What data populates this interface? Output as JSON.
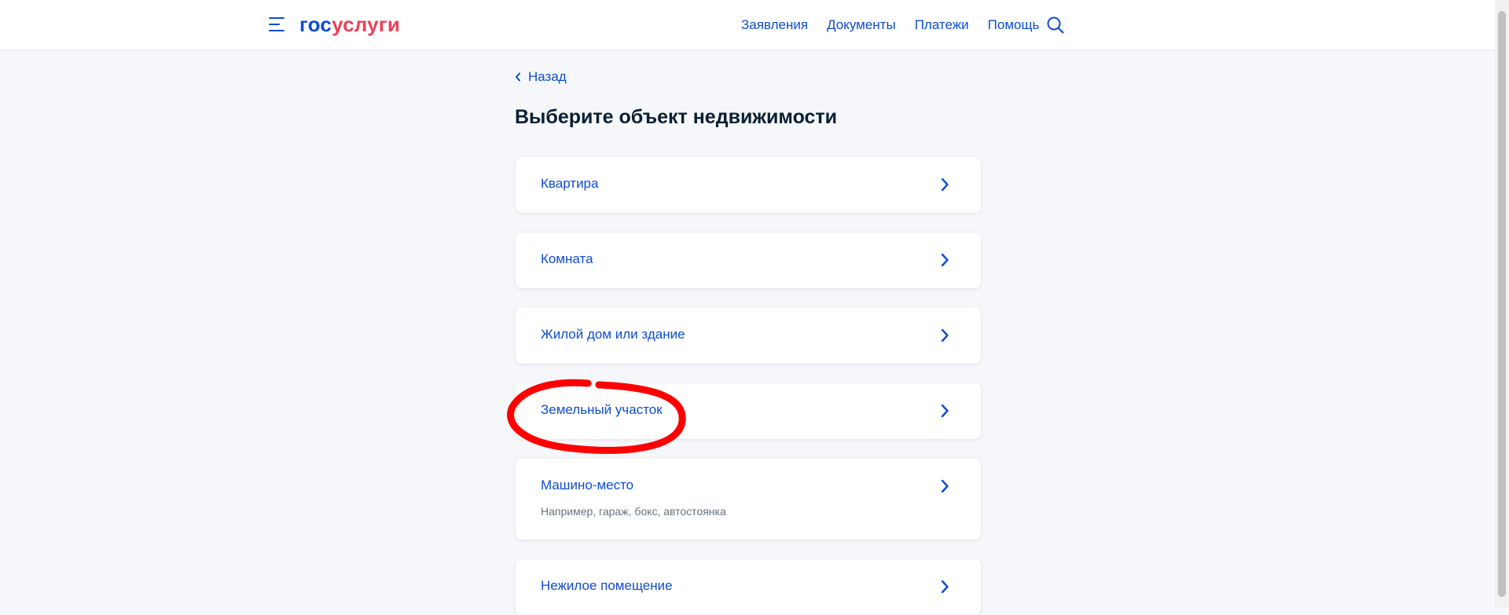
{
  "header": {
    "logo_part1": "гос",
    "logo_part2": "услуги",
    "nav": [
      "Заявления",
      "Документы",
      "Платежи",
      "Помощь"
    ]
  },
  "back_label": "Назад",
  "page_title": "Выберите объект недвижимости",
  "options": [
    {
      "label": "Квартира"
    },
    {
      "label": "Комната"
    },
    {
      "label": "Жилой дом или здание"
    },
    {
      "label": "Земельный участок"
    },
    {
      "label": "Машино-место",
      "description": "Например, гараж, бокс, автостоянка"
    },
    {
      "label": "Нежилое помещение"
    }
  ],
  "colors": {
    "accent": "#0d4cd3",
    "brand_red": "#ee3f58",
    "annotation": "#ff0000",
    "page_bg": "#f5f7fa"
  },
  "icons": {
    "menu": "hamburger-icon",
    "search": "search-icon",
    "back": "chevron-left-icon",
    "option": "chevron-right-icon"
  }
}
